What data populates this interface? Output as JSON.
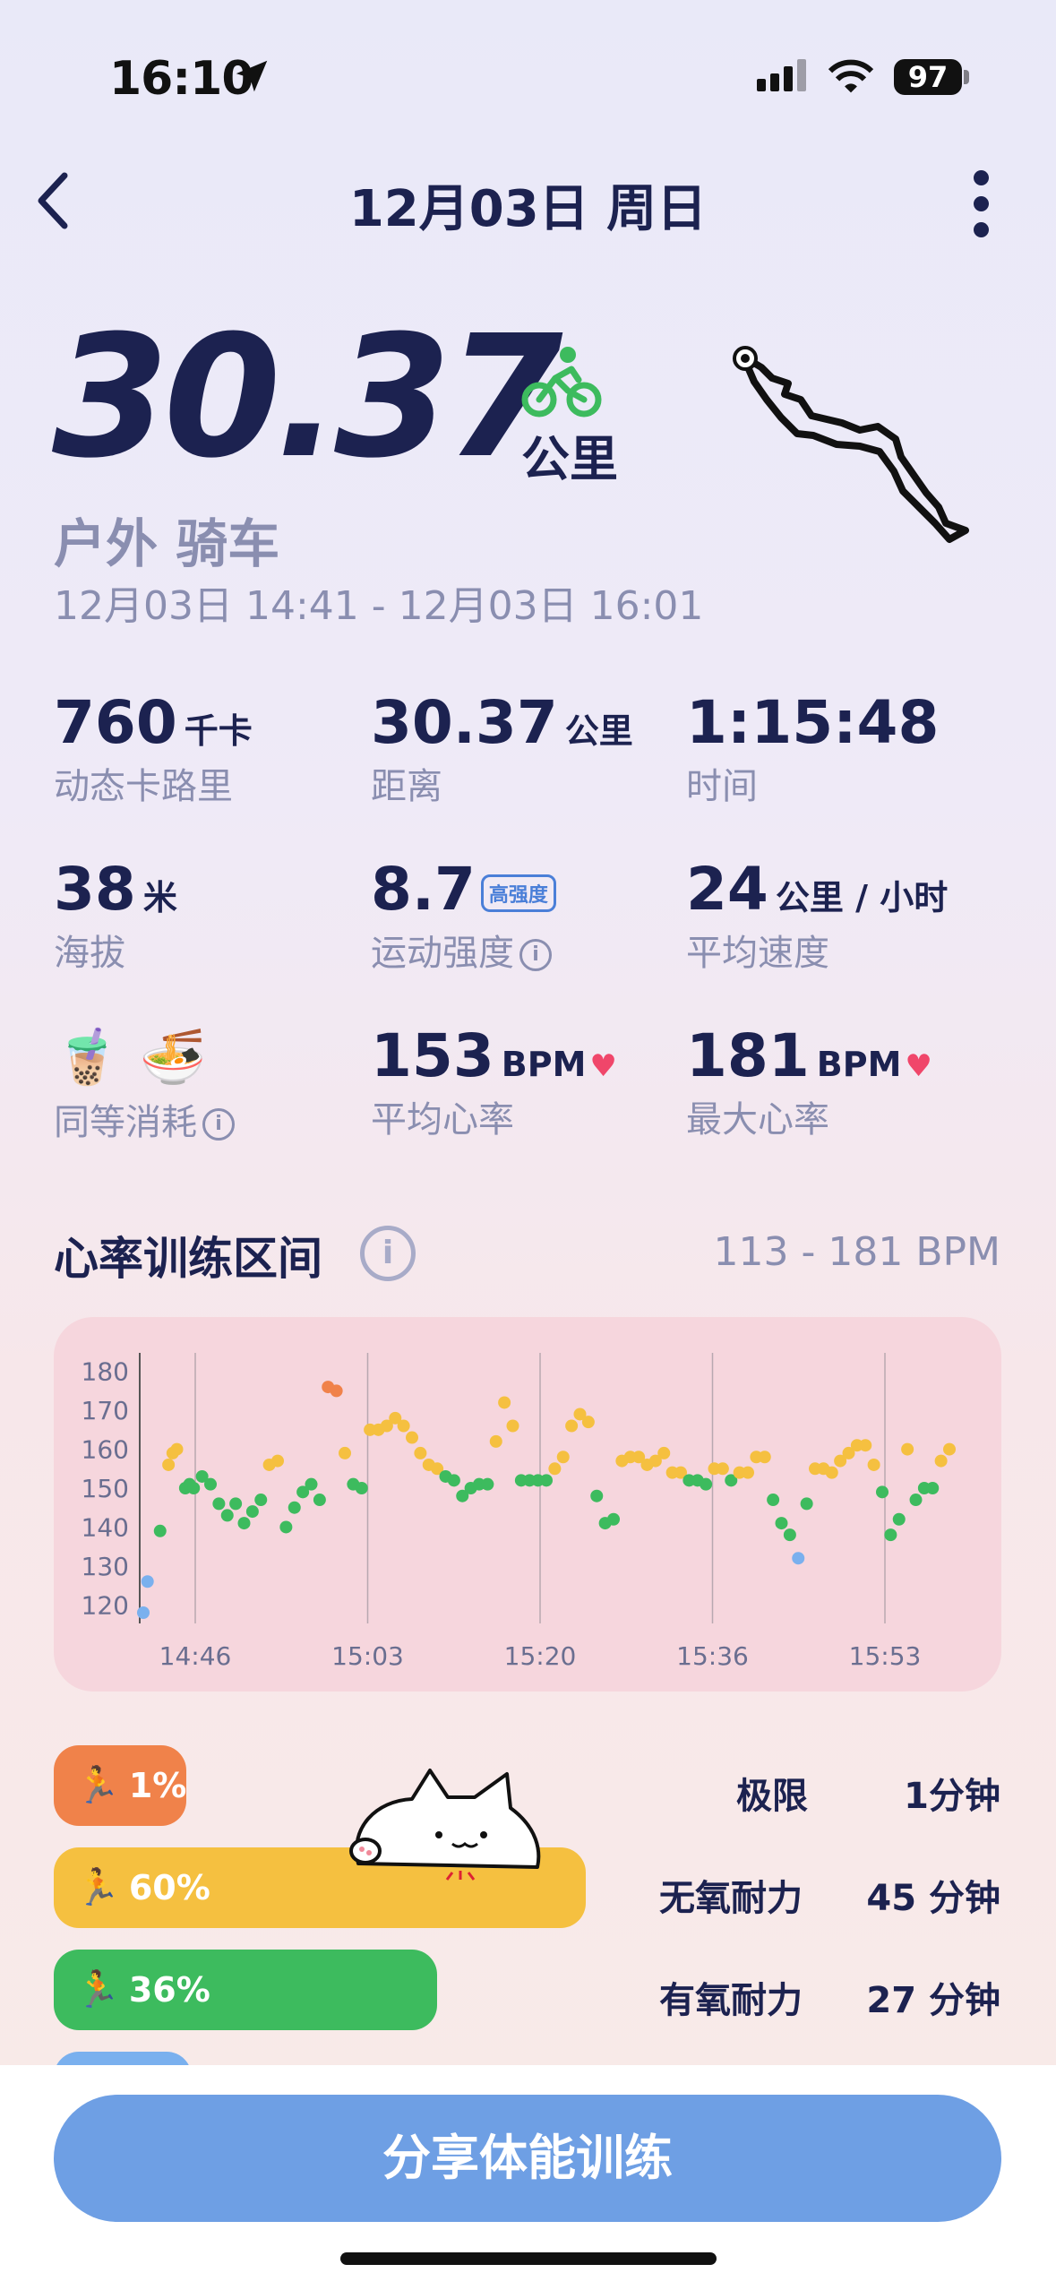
{
  "status_bar": {
    "time": "16:10",
    "battery": "97"
  },
  "nav": {
    "title": "12月03日 周日"
  },
  "hero": {
    "distance": "30.37",
    "unit": "公里",
    "activity": "户外 骑车",
    "time_range": "12月03日 14:41 - 12月03日 16:01"
  },
  "stats": [
    {
      "value": "760",
      "unit": "千卡",
      "label": "动态卡路里"
    },
    {
      "value": "30.37",
      "unit": "公里",
      "label": "距离"
    },
    {
      "value": "1:15:48",
      "unit": "",
      "label": "时间"
    },
    {
      "value": "38",
      "unit": "米",
      "label": "海拔"
    },
    {
      "value": "8.7",
      "badge": "高强度",
      "label": "运动强度"
    },
    {
      "value": "24",
      "unit": "公里 / 小时",
      "label": "平均速度"
    },
    {
      "icons": "🧋 🍜",
      "label": "同等消耗"
    },
    {
      "value": "153",
      "unit": "BPM",
      "label": "平均心率"
    },
    {
      "value": "181",
      "unit": "BPM",
      "label": "最大心率"
    }
  ],
  "hr_section": {
    "title": "心率训练区间",
    "range": "113 - 181 BPM"
  },
  "chart_data": {
    "type": "scatter",
    "title": "",
    "xlabel": "",
    "ylabel": "",
    "y_ticks": [
      "180",
      "170",
      "160",
      "150",
      "140",
      "130",
      "120"
    ],
    "x_ticks": [
      "14:46",
      "15:03",
      "15:20",
      "15:36",
      "15:53"
    ],
    "ylim": [
      118,
      182
    ],
    "grid": "vertical",
    "legend": "none",
    "colors": {
      "extreme": "#f0824a",
      "anaerobic": "#f5c040",
      "aerobic": "#3dbb5e",
      "light": "#7ab0ee"
    },
    "zone_thresholds": {
      "light_max": 133,
      "aerobic_max": 153,
      "anaerobic_max": 172
    },
    "x_units": "minutes since 14:41",
    "series_points": [
      [
        0,
        118
      ],
      [
        0.5,
        126
      ],
      [
        2,
        139
      ],
      [
        3,
        156
      ],
      [
        3.5,
        159
      ],
      [
        4,
        160
      ],
      [
        5,
        150
      ],
      [
        5.5,
        151
      ],
      [
        6,
        150
      ],
      [
        7,
        153
      ],
      [
        8,
        151
      ],
      [
        9,
        146
      ],
      [
        10,
        143
      ],
      [
        11,
        146
      ],
      [
        12,
        141
      ],
      [
        13,
        144
      ],
      [
        14,
        147
      ],
      [
        15,
        156
      ],
      [
        16,
        157
      ],
      [
        17,
        140
      ],
      [
        18,
        145
      ],
      [
        19,
        149
      ],
      [
        20,
        151
      ],
      [
        21,
        147
      ],
      [
        22,
        176
      ],
      [
        23,
        175
      ],
      [
        24,
        159
      ],
      [
        25,
        151
      ],
      [
        26,
        150
      ],
      [
        27,
        165
      ],
      [
        28,
        165
      ],
      [
        29,
        166
      ],
      [
        30,
        168
      ],
      [
        31,
        166
      ],
      [
        32,
        163
      ],
      [
        33,
        159
      ],
      [
        34,
        156
      ],
      [
        35,
        155
      ],
      [
        36,
        153
      ],
      [
        37,
        152
      ],
      [
        38,
        148
      ],
      [
        39,
        150
      ],
      [
        40,
        151
      ],
      [
        41,
        151
      ],
      [
        42,
        162
      ],
      [
        43,
        172
      ],
      [
        44,
        166
      ],
      [
        45,
        152
      ],
      [
        46,
        152
      ],
      [
        47,
        152
      ],
      [
        48,
        152
      ],
      [
        49,
        155
      ],
      [
        50,
        158
      ],
      [
        51,
        166
      ],
      [
        52,
        169
      ],
      [
        53,
        167
      ],
      [
        54,
        148
      ],
      [
        55,
        141
      ],
      [
        56,
        142
      ],
      [
        57,
        157
      ],
      [
        58,
        158
      ],
      [
        59,
        158
      ],
      [
        60,
        156
      ],
      [
        61,
        157
      ],
      [
        62,
        159
      ],
      [
        63,
        154
      ],
      [
        64,
        154
      ],
      [
        65,
        152
      ],
      [
        66,
        152
      ],
      [
        67,
        151
      ],
      [
        68,
        155
      ],
      [
        69,
        155
      ],
      [
        70,
        152
      ],
      [
        71,
        154
      ],
      [
        72,
        154
      ],
      [
        73,
        158
      ],
      [
        74,
        158
      ],
      [
        75,
        147
      ],
      [
        76,
        141
      ],
      [
        77,
        138
      ],
      [
        78,
        132
      ],
      [
        79,
        146
      ],
      [
        80,
        155
      ],
      [
        81,
        155
      ],
      [
        82,
        154
      ],
      [
        83,
        157
      ],
      [
        84,
        159
      ],
      [
        85,
        161
      ],
      [
        86,
        161
      ],
      [
        87,
        156
      ],
      [
        88,
        149
      ],
      [
        89,
        138
      ],
      [
        90,
        142
      ],
      [
        91,
        160
      ],
      [
        92,
        147
      ],
      [
        93,
        150
      ],
      [
        94,
        150
      ],
      [
        95,
        157
      ],
      [
        96,
        160
      ]
    ]
  },
  "zones": [
    {
      "percent": "1%",
      "color": "#f0824a",
      "fill": 0.01,
      "name": "极限",
      "time": "1分钟"
    },
    {
      "percent": "60%",
      "color": "#f5c040",
      "fill": 0.6,
      "name": "无氧耐力",
      "time": "45 分钟"
    },
    {
      "percent": "36%",
      "color": "#3dbb5e",
      "fill": 0.36,
      "name": "有氧耐力",
      "time": "27 分钟"
    }
  ],
  "share_button": "分享体能训练"
}
